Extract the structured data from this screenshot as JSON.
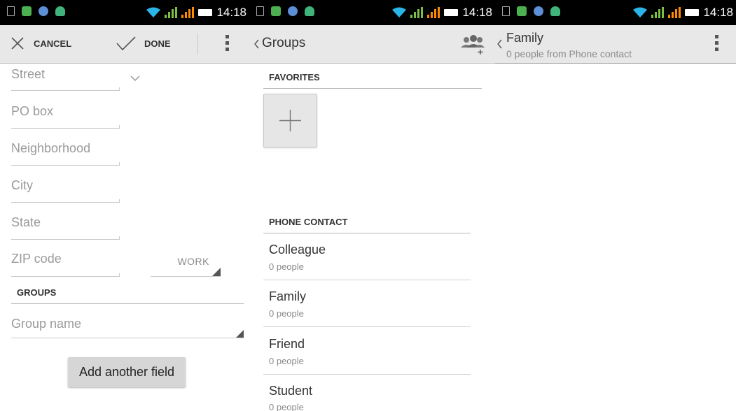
{
  "status_bar": {
    "time": "14:18"
  },
  "edit_screen": {
    "cancel_label": "CANCEL",
    "done_label": "DONE",
    "fields": [
      {
        "placeholder": "Street"
      },
      {
        "placeholder": "PO box"
      },
      {
        "placeholder": "Neighborhood"
      },
      {
        "placeholder": "City"
      },
      {
        "placeholder": "State"
      },
      {
        "placeholder": "ZIP code"
      }
    ],
    "address_type": "WORK",
    "groups_header": "GROUPS",
    "group_name_placeholder": "Group name",
    "add_field_label": "Add another field"
  },
  "groups_screen": {
    "title": "Groups",
    "favorites_header": "FAVORITES",
    "phone_contact_header": "PHONE CONTACT",
    "groups": [
      {
        "name": "Colleague",
        "count": "0 people"
      },
      {
        "name": "Family",
        "count": "0 people"
      },
      {
        "name": "Friend",
        "count": "0 people"
      },
      {
        "name": "Student",
        "count": "0 people"
      }
    ]
  },
  "group_detail_screen": {
    "title": "Family",
    "subtitle": "0 people from Phone contact"
  },
  "colors": {
    "accent_green": "#7bc043",
    "accent_orange": "#ff8a00",
    "wifi_blue": "#2ab4e8"
  }
}
